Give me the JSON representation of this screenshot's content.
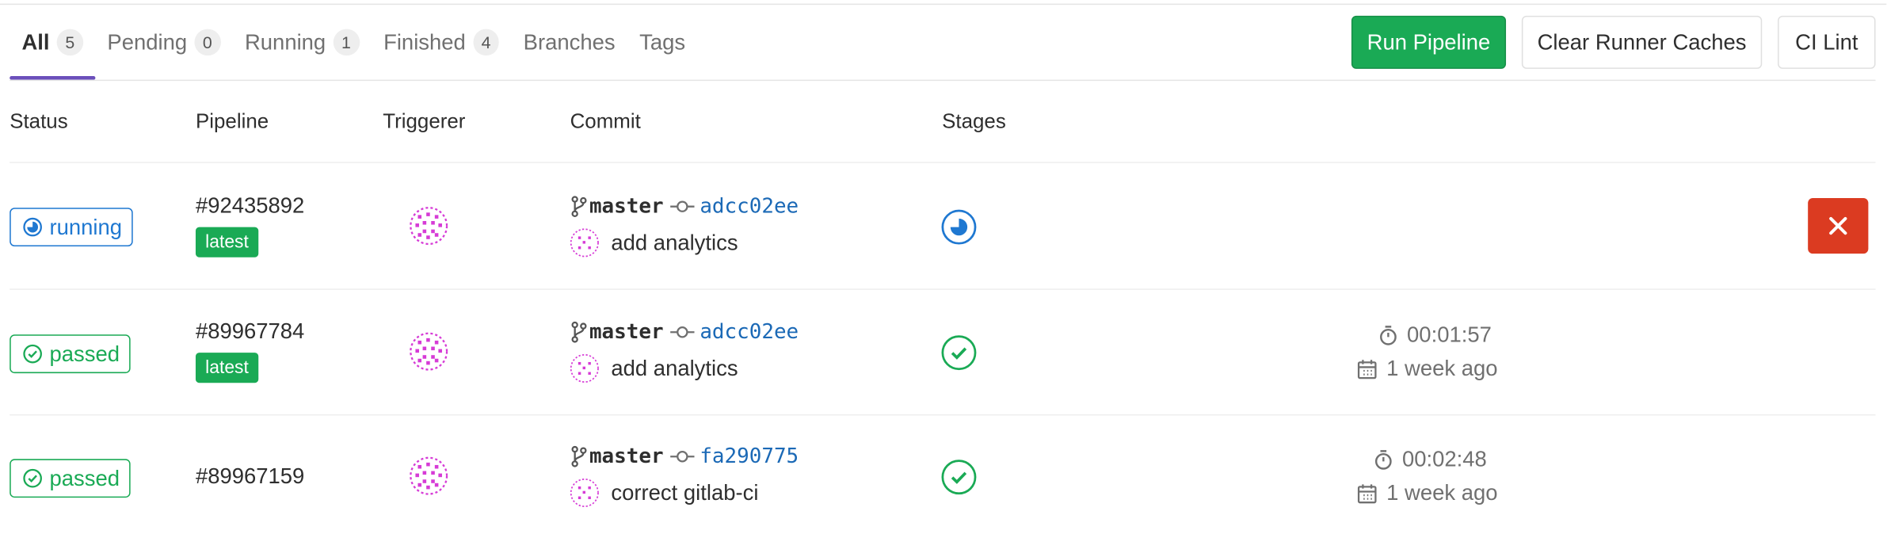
{
  "tabs": [
    {
      "label": "All",
      "count": "5"
    },
    {
      "label": "Pending",
      "count": "0"
    },
    {
      "label": "Running",
      "count": "1"
    },
    {
      "label": "Finished",
      "count": "4"
    },
    {
      "label": "Branches"
    },
    {
      "label": "Tags"
    }
  ],
  "actions": {
    "run_pipeline": "Run Pipeline",
    "clear_caches": "Clear Runner Caches",
    "ci_lint": "CI Lint"
  },
  "columns": {
    "status": "Status",
    "pipeline": "Pipeline",
    "triggerer": "Triggerer",
    "commit": "Commit",
    "stages": "Stages"
  },
  "pipelines": [
    {
      "status": "running",
      "id": "#92435892",
      "badge": "latest",
      "branch": "master",
      "sha": "adcc02ee",
      "message": "add analytics",
      "stage_status": "running-icon"
    },
    {
      "status": "passed",
      "id": "#89967784",
      "badge": "latest",
      "branch": "master",
      "sha": "adcc02ee",
      "message": "add analytics",
      "stage_status": "success-icon",
      "duration": "00:01:57",
      "finished": "1 week ago"
    },
    {
      "status": "passed",
      "id": "#89967159",
      "branch": "master",
      "sha": "fa290775",
      "message": "correct gitlab-ci",
      "stage_status": "success-icon",
      "duration": "00:02:48",
      "finished": "1 week ago"
    }
  ],
  "colors": {
    "primary": "#1aaa55",
    "running": "#1f78d1",
    "danger": "#db3b21",
    "tab_active": "#6b4fbb",
    "link": "#1b69b6"
  }
}
